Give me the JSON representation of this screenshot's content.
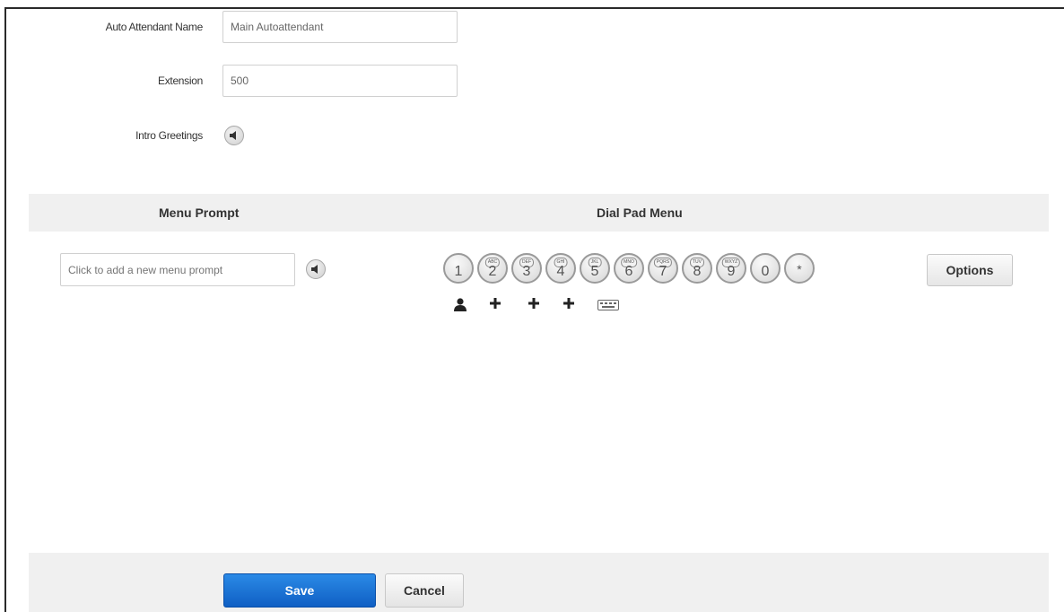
{
  "form": {
    "name_label": "Auto Attendant Name",
    "name_value": "Main Autoattendant",
    "extension_label": "Extension",
    "extension_value": "500",
    "intro_label": "Intro Greetings",
    "intro_icon": "speaker-icon"
  },
  "section": {
    "menu_prompt_header": "Menu Prompt",
    "dial_pad_header": "Dial Pad Menu"
  },
  "menu_prompt": {
    "placeholder": "Click to add a new menu prompt",
    "icon": "speaker-icon"
  },
  "dial_pad": {
    "keys": [
      {
        "digit": "1",
        "letters": ""
      },
      {
        "digit": "2",
        "letters": "ABC"
      },
      {
        "digit": "3",
        "letters": "DEF"
      },
      {
        "digit": "4",
        "letters": "GHI"
      },
      {
        "digit": "5",
        "letters": "JKL"
      },
      {
        "digit": "6",
        "letters": "MNO"
      },
      {
        "digit": "7",
        "letters": "PQRS"
      },
      {
        "digit": "8",
        "letters": "TUV"
      },
      {
        "digit": "9",
        "letters": "WXYZ"
      },
      {
        "digit": "0",
        "letters": ""
      },
      {
        "digit": "*",
        "letters": ""
      }
    ],
    "actions": [
      "user-icon",
      "plus-icon",
      "plus-icon",
      "plus-icon",
      "keyboard-icon"
    ],
    "options_label": "Options"
  },
  "footer": {
    "save_label": "Save",
    "cancel_label": "Cancel"
  },
  "colors": {
    "primary": "#1a6fd4",
    "band_background": "#f0f0f0"
  }
}
